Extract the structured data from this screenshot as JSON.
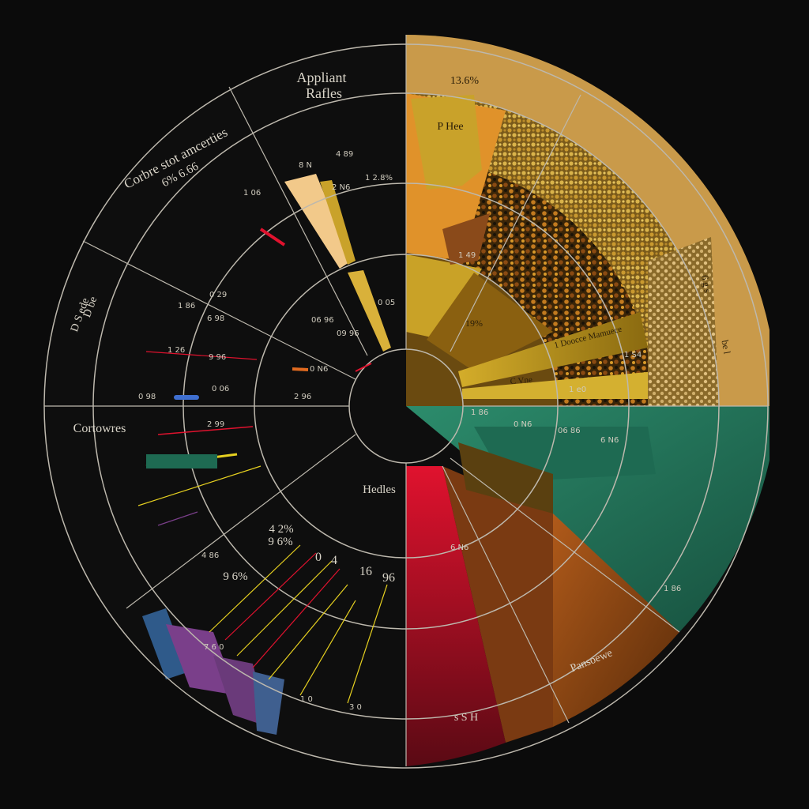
{
  "diagram": {
    "labels": {
      "top_title_line1": "Appliant",
      "top_title_line2": "Rafles",
      "upper_left_line1": "Corbre stot amcerties",
      "upper_left_line2": "6% 6.66",
      "left_vertical_line1": "D be",
      "left_vertical_line2": "D S ede",
      "left_mid": "Cortowres",
      "center_right_mid": "Hedles",
      "top_right_band": "13.6%",
      "top_right_label": "P Hee",
      "right_vertical_1": "6 g s",
      "right_vertical_2": "be l",
      "inner_gold_pct": "19%",
      "inner_gold_band_label": "1 Doocce Mamuece",
      "inner_gold_band_label2": "C Vne",
      "gold_small_1": "1 49",
      "gold_small_2": "1 S4",
      "gold_small_3": "1 e0",
      "teal_small_1": "1 86",
      "teal_small_2": "0 N6",
      "teal_small_3": "06 86",
      "teal_small_4": "6 N6",
      "teal_small_5": "1 86",
      "brown_label": "Pansoewe",
      "red_bottom": "s S H",
      "brown_small": "6 N6",
      "pct_top_inner": "1 2.8%",
      "small_a": "8 N",
      "small_b": "4 89",
      "small_c": "2 N6",
      "small_d": "1 06",
      "small_e": "1 86",
      "small_f": "0 29",
      "small_g": "6 98",
      "small_h": "1 26",
      "small_i": "9 96",
      "small_j": "0 98",
      "small_k": "0 06",
      "small_l": "06 96",
      "small_m": "09 96",
      "small_n": "0 05",
      "bottom_pct_1": "4 2%",
      "bottom_pct_2": "9 6%",
      "bottom_pct_3": "9 6%",
      "bottom_num_1": "0",
      "bottom_num_2": "4",
      "bottom_num_3": "16",
      "bottom_num_4": "96",
      "bottom_small_1": "4 86",
      "bottom_small_2": "7 6 0",
      "bottom_small_3": "1 0",
      "bottom_small_4": "3 0",
      "mid_left_1": "0 N6",
      "mid_left_2": "2 96",
      "mid_left_3": "2 99"
    },
    "colors": {
      "background": "#0b0b0b",
      "lines": "#bdb8ad",
      "gold": "#c9a227",
      "mustard": "#a88a1a",
      "orange": "#e58a1f",
      "tan": "#c89a4a",
      "teal": "#2f8a6a",
      "red": "#c8102e",
      "maroon": "#6b0f1a",
      "brown": "#9a4f1a",
      "purple": "#7a3f8a",
      "blue": "#2f5a8a"
    }
  }
}
